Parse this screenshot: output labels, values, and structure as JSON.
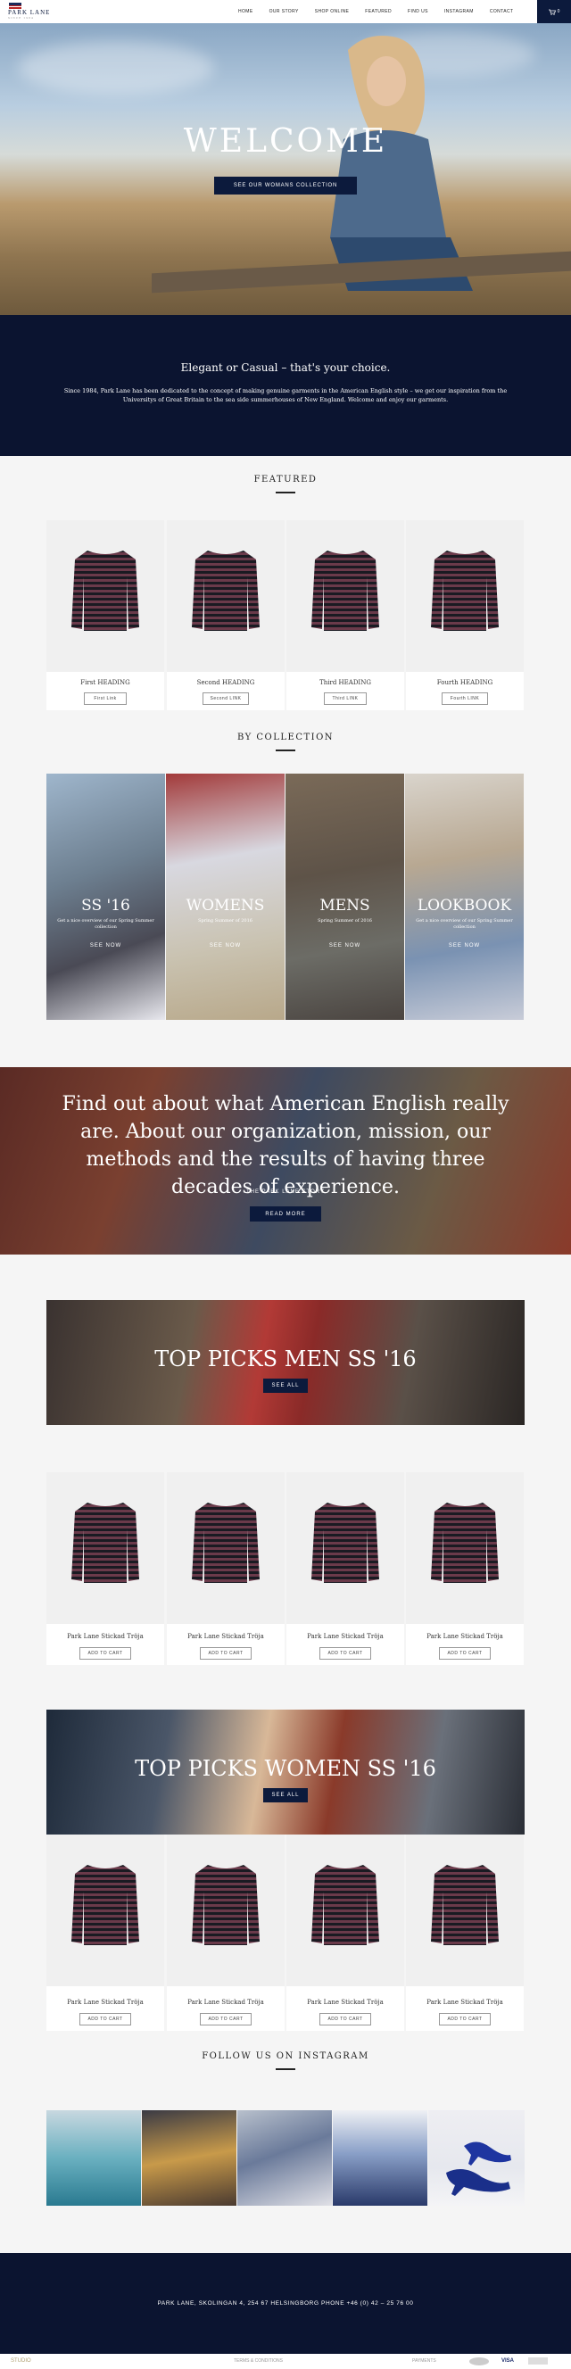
{
  "header": {
    "logo": "PARK LANE",
    "logo_sub": "SINCE 1984",
    "nav": [
      "HOME",
      "OUR STORY",
      "SHOP ONLINE",
      "FEATURED",
      "FIND US",
      "INSTAGRAM",
      "CONTACT"
    ],
    "cart": "0"
  },
  "hero": {
    "title": "WELCOME",
    "button": "SEE OUR WOMANS COLLECTION"
  },
  "intro": {
    "heading": "Elegant or Casual – that's your choice.",
    "text": "Since 1984, Park Lane has been dedicated to the concept of making genuine garments in the American English style – we get our inspiration from the Universitys of Great Britain to the sea side summerhouses of New England. Welcome and enjoy our garments."
  },
  "featured": {
    "title": "FEATURED",
    "items": [
      {
        "name": "First HEADING",
        "link": "First Link"
      },
      {
        "name": "Second HEADING",
        "link": "Second LINK"
      },
      {
        "name": "Third HEADING",
        "link": "Third LINK"
      },
      {
        "name": "Fourth HEADING",
        "link": "Fourth LINK"
      }
    ]
  },
  "collection": {
    "title": "BY COLLECTION",
    "items": [
      {
        "title": "SS '16",
        "sub": "Get a nice overview of our Spring Summer collection",
        "shop": "SEE NOW"
      },
      {
        "title": "WOMENS",
        "sub": "Spring Summer of 2016",
        "shop": "SEE NOW"
      },
      {
        "title": "MENS",
        "sub": "Spring Summer of 2016",
        "shop": "SEE NOW"
      },
      {
        "title": "LOOKBOOK",
        "sub": "Get a nice overview of our Spring Summer collection",
        "shop": "SEE NOW"
      }
    ]
  },
  "about": {
    "text": "Find out about what American English really are. About our organization, mission, our methods and the results of having three decades of experience.",
    "story": "THE PARK LANE STORY",
    "button": "READ MORE"
  },
  "men": {
    "title": "TOP PICKS MEN SS '16",
    "button": "SEE ALL",
    "items": [
      {
        "name": "Park Lane Stickad Tröja",
        "button": "ADD TO CART"
      },
      {
        "name": "Park Lane Stickad Tröja",
        "button": "ADD TO CART"
      },
      {
        "name": "Park Lane Stickad Tröja",
        "button": "ADD TO CART"
      },
      {
        "name": "Park Lane Stickad Tröja",
        "button": "ADD TO CART"
      }
    ]
  },
  "women": {
    "title": "TOP PICKS WOMEN SS '16",
    "button": "SEE ALL",
    "items": [
      {
        "name": "Park Lane Stickad Tröja",
        "button": "ADD TO CART"
      },
      {
        "name": "Park Lane Stickad Tröja",
        "button": "ADD TO CART"
      },
      {
        "name": "Park Lane Stickad Tröja",
        "button": "ADD TO CART"
      },
      {
        "name": "Park Lane Stickad Tröja",
        "button": "ADD TO CART"
      }
    ]
  },
  "instagram": {
    "title": "FOLLOW US ON INSTAGRAM"
  },
  "footer": {
    "address": "PARK LANE, SKOLINGAN 4, 254 67 HELSINGBORG PHONE +46 (0) 42 – 25 76 00",
    "logo": "STUDIO",
    "terms": "TERMS & CONDITIONS",
    "payment": "PAYMENTS",
    "visa": "VISA"
  },
  "colors": {
    "navy": "#0b1430",
    "accent": "#0c1a3c"
  }
}
